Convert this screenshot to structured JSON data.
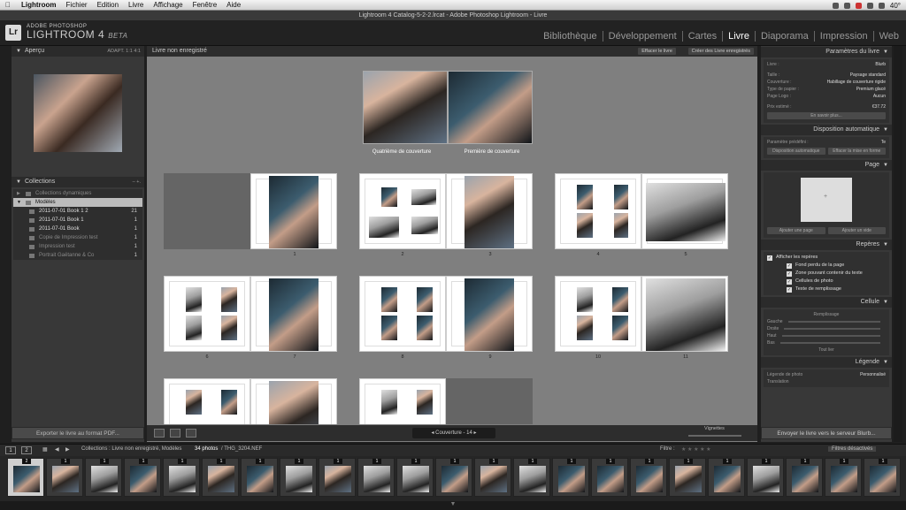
{
  "menubar": {
    "apple": "",
    "items": [
      "Lightroom",
      "Fichier",
      "Edition",
      "Livre",
      "Affichage",
      "Fenêtre",
      "Aide"
    ],
    "status_text": "40°"
  },
  "window": {
    "title": "Lightroom 4 Catalog-5-2-2.lrcat - Adobe Photoshop Lightroom - Livre"
  },
  "identity": {
    "logo": "Lr",
    "brand_small": "ADOBE PHOTOSHOP",
    "brand_big": "LIGHTROOM 4",
    "beta": "BETA",
    "modules": [
      "Bibliothèque",
      "Développement",
      "Cartes",
      "Livre",
      "Diaporama",
      "Impression",
      "Web"
    ],
    "active_module": "Livre"
  },
  "left": {
    "preview_header": "Aperçu",
    "preview_zoom": "ADAPT.   1:1   4:1",
    "collections_header": "Collections",
    "collections_controls": "–  +.",
    "collections": [
      {
        "label": "Collections dynamiques",
        "count": ""
      },
      {
        "label": "Modèles",
        "count": ""
      },
      {
        "label": "2011-07-01 Book 1 2",
        "count": "21"
      },
      {
        "label": "2011-07-01 Book 1",
        "count": "1"
      },
      {
        "label": "2011-07-01 Book",
        "count": "1"
      },
      {
        "label": "Copie de Impression test",
        "count": "1"
      },
      {
        "label": "Impression test",
        "count": "1"
      },
      {
        "label": "Portrait Gaëtanne & Co",
        "count": "1"
      }
    ],
    "export_button": "Exporter le livre au format PDF..."
  },
  "center": {
    "title": "Livre non enregistré",
    "clear_button": "Effacer le livre",
    "create_button": "Créer des Livre enregistrés",
    "cover_back_label": "Quatrième de couverture",
    "cover_front_label": "Première de couverture",
    "page_numbers": [
      "1",
      "2",
      "3",
      "4",
      "5",
      "6",
      "7",
      "8",
      "9",
      "10",
      "11"
    ],
    "pager_label": "Couverture - 14",
    "vignette_label": "Vignettes"
  },
  "right": {
    "book_settings_header": "Paramètres du livre",
    "book_settings": [
      {
        "k": "Livre :",
        "v": "Blurb"
      },
      {
        "k": "Taille :",
        "v": "Paysage standard"
      },
      {
        "k": "Couverture :",
        "v": "Habillage de couverture rigide"
      },
      {
        "k": "Type de papier :",
        "v": "Premium glacé"
      },
      {
        "k": "Page Logo :",
        "v": "Aucun"
      },
      {
        "k": "Prix estimé :",
        "v": "€37.72"
      }
    ],
    "more_button": "En savoir plus...",
    "auto_layout_header": "Disposition automatique",
    "preset_label": "Paramètre prédéfini :",
    "preset_value": "Te",
    "auto_button": "Disposition automatique",
    "clear_layout_button": "Effacer la mise en forme",
    "page_header": "Page",
    "add_page_button": "Ajouter une page",
    "add_blank_button": "Ajouter un vide",
    "guides_header": "Repères",
    "show_guides": "Afficher les repères",
    "guides": [
      "Fond perdu de la page",
      "Zone pouvant contenir du texte",
      "Cellules de photo",
      "Texte de remplissage"
    ],
    "cell_header": "Cellule",
    "padding_label": "Remplissage",
    "padding_rows": [
      "Gauche",
      "Droite",
      "Haut",
      "Bas"
    ],
    "link_all": "Tout lier",
    "caption_header": "Légende",
    "caption_label": "Légende de photo",
    "caption_value": "Personnalisé",
    "translation": "Translation",
    "send_button": "Envoyer le livre vers le serveur Blurb..."
  },
  "filmbar": {
    "page1": "1",
    "page2": "2",
    "source": "Collections : Livre non enregistré, Modèles",
    "count": "34 photos",
    "file": "/ THG_3204.NEF",
    "filter_label": "Filtre :",
    "filter_state": "Filtres désactivés"
  },
  "filmstrip": {
    "count_badges": [
      "2",
      "1",
      "1",
      "1",
      "1",
      "1",
      "1",
      "1",
      "1",
      "1",
      "1",
      "1",
      "1",
      "1",
      "1",
      "1",
      "1",
      "1",
      "1",
      "1",
      "1",
      "1",
      "1"
    ]
  }
}
